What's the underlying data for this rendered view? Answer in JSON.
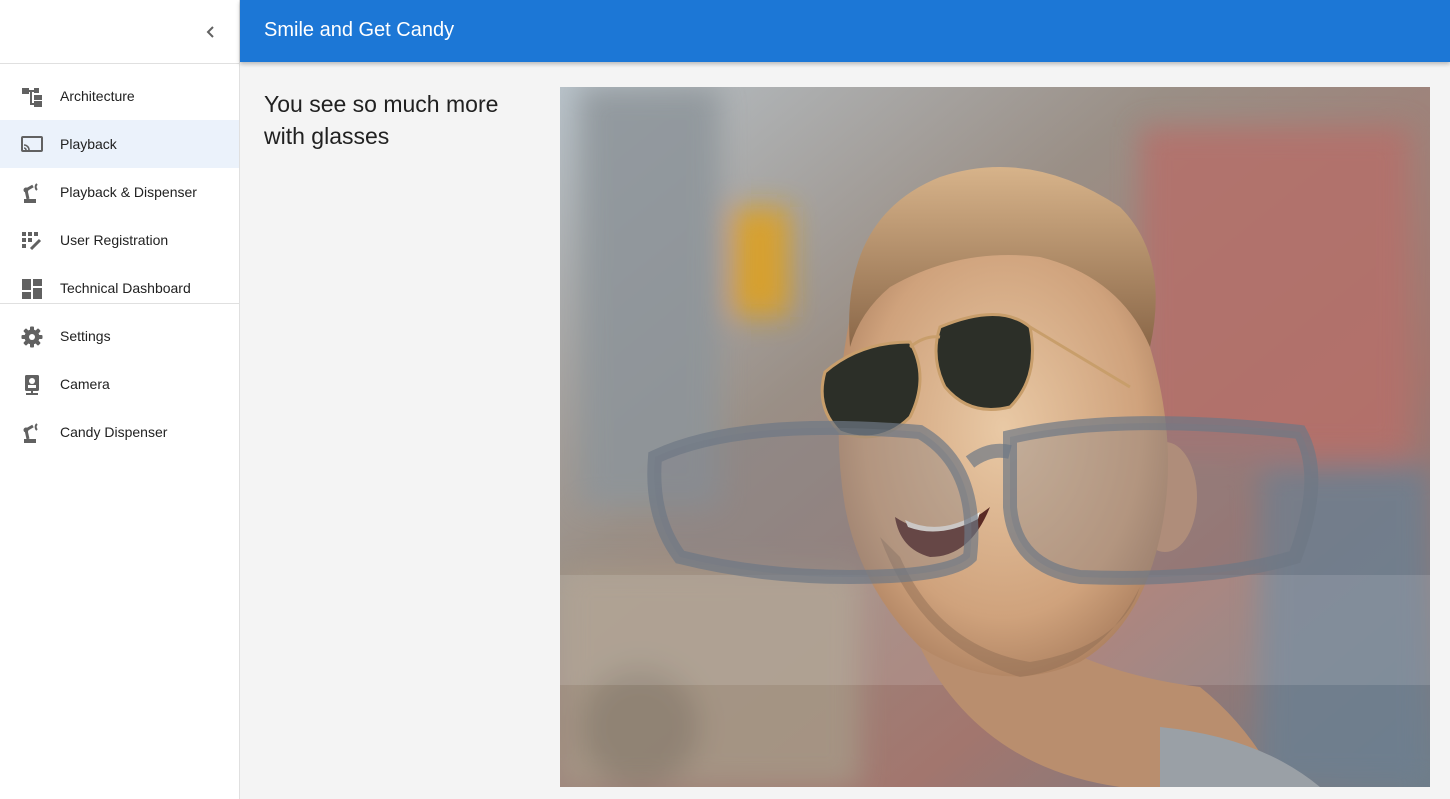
{
  "app": {
    "title": "Smile and Get Candy"
  },
  "sidebar": {
    "collapse_icon": "chevron-left-icon",
    "groups": [
      {
        "items": [
          {
            "label": "Architecture",
            "icon": "architecture-icon"
          },
          {
            "label": "Playback",
            "icon": "cast-screen-icon",
            "active": true
          },
          {
            "label": "Playback & Dispenser",
            "icon": "robot-arm-icon"
          },
          {
            "label": "User Registration",
            "icon": "user-registration-icon"
          },
          {
            "label": "Technical Dashboard",
            "icon": "dashboard-icon"
          }
        ]
      },
      {
        "items": [
          {
            "label": "Settings",
            "icon": "gear-icon"
          },
          {
            "label": "Camera",
            "icon": "camera-icon"
          },
          {
            "label": "Candy Dispenser",
            "icon": "robot-arm-icon"
          }
        ]
      }
    ]
  },
  "main": {
    "headline": "You see so much more with glasses"
  },
  "colors": {
    "accent": "#1c77d6",
    "active_item_bg": "#ebf2fb"
  }
}
